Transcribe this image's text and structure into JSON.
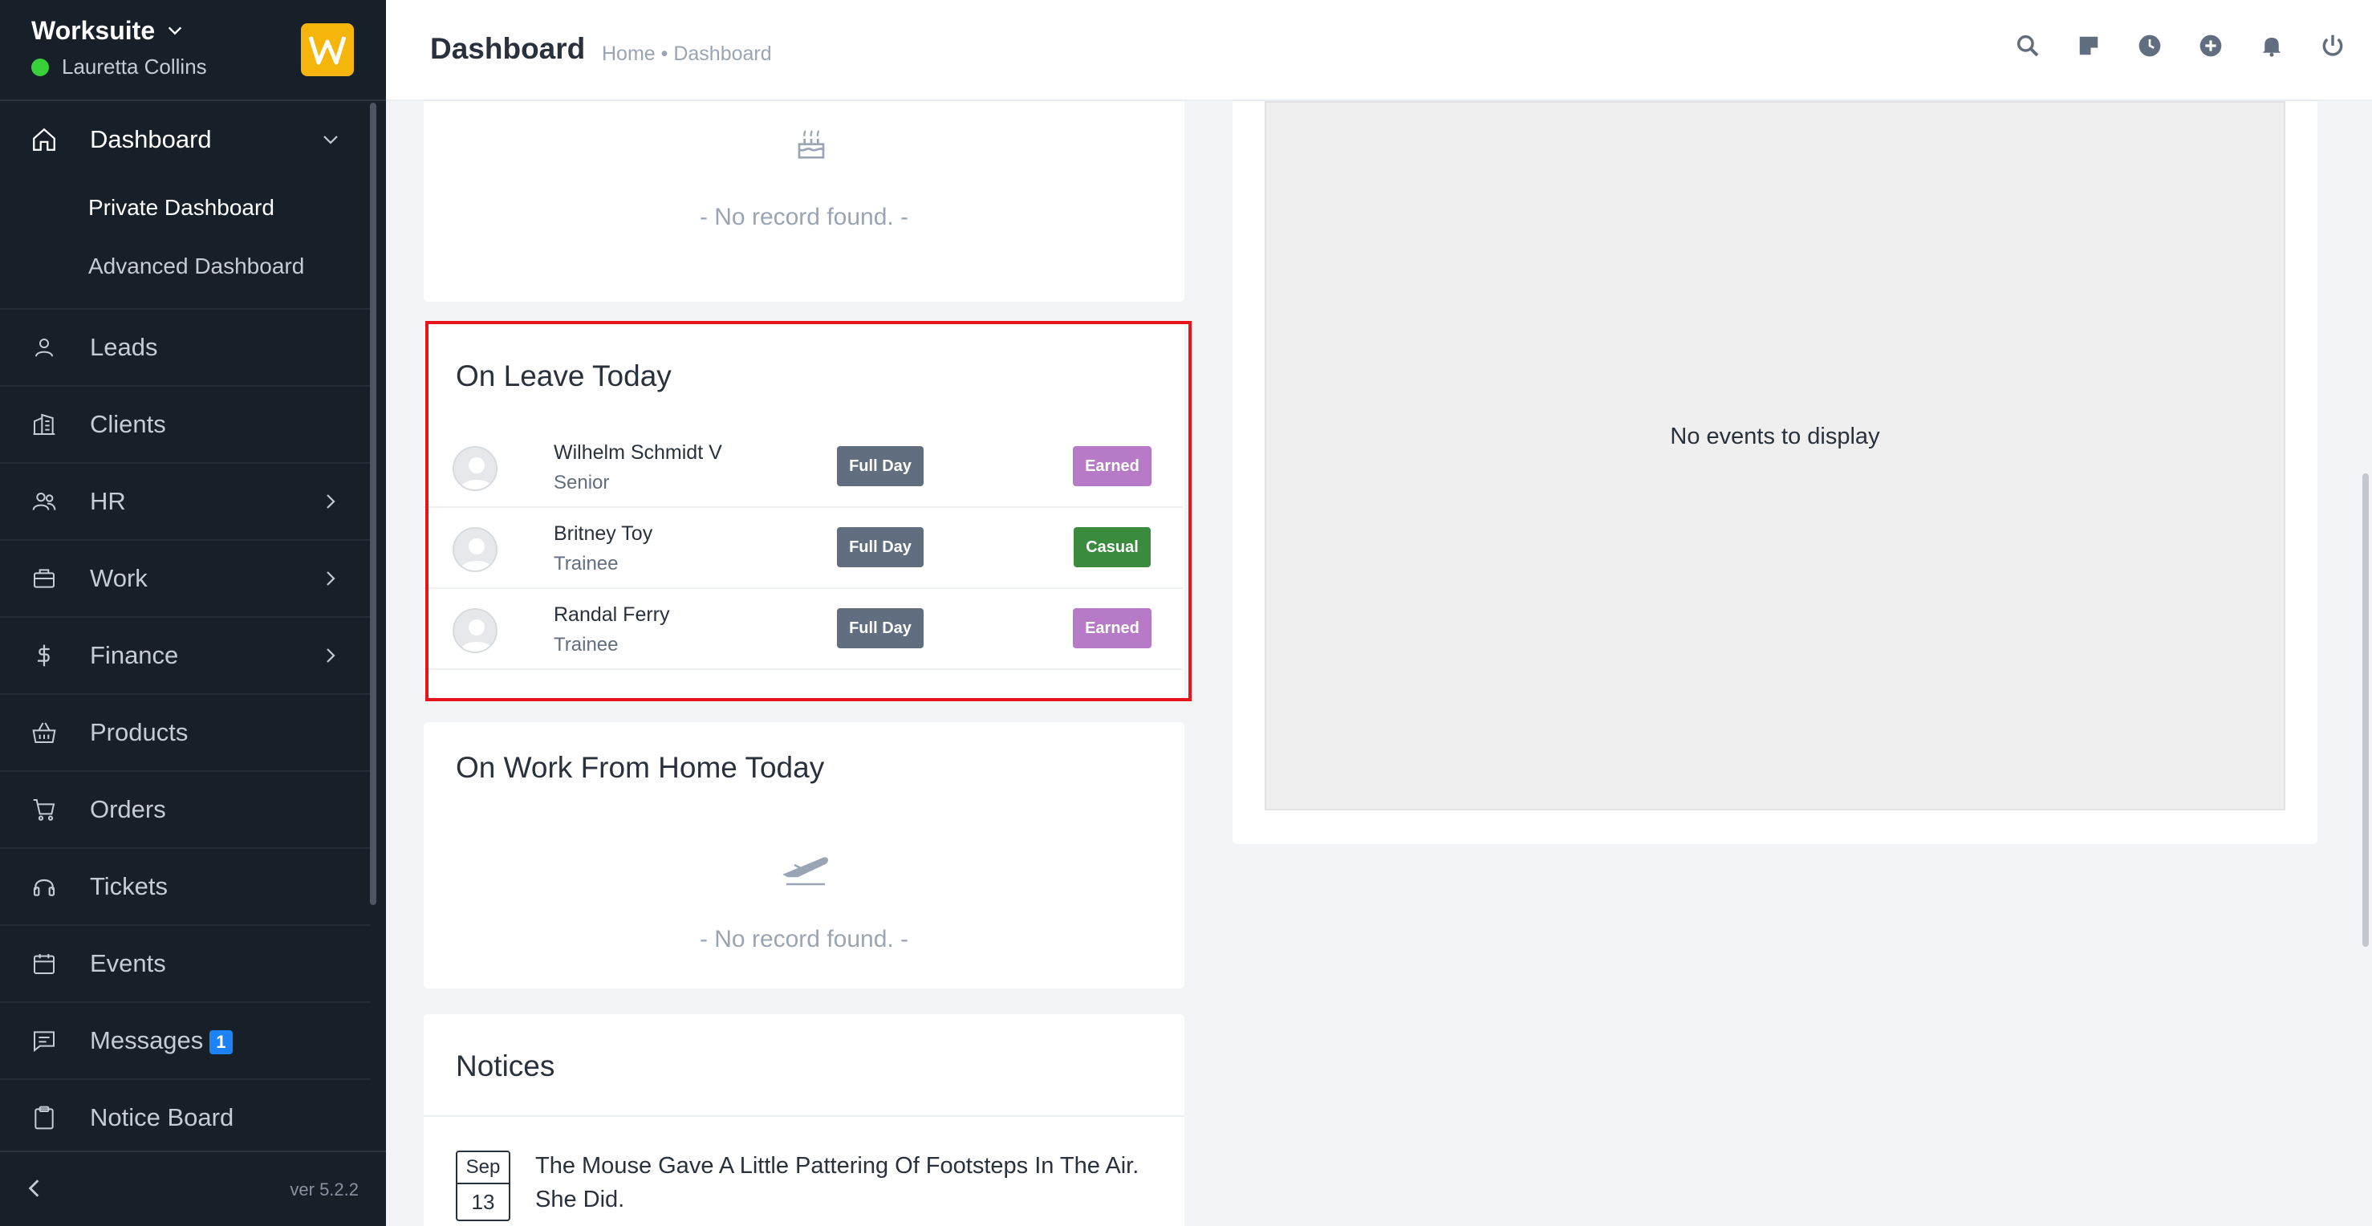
{
  "sidebar": {
    "company": "Worksuite",
    "user": "Lauretta Collins",
    "version": "ver 5.2.2",
    "nav": [
      {
        "label": "Dashboard",
        "icon": "home-icon",
        "expanded": true
      },
      {
        "label": "Leads",
        "icon": "user-icon"
      },
      {
        "label": "Clients",
        "icon": "building-icon"
      },
      {
        "label": "HR",
        "icon": "users-icon"
      },
      {
        "label": "Work",
        "icon": "briefcase-icon"
      },
      {
        "label": "Finance",
        "icon": "dollar-icon"
      },
      {
        "label": "Products",
        "icon": "basket-icon"
      },
      {
        "label": "Orders",
        "icon": "cart-icon"
      },
      {
        "label": "Tickets",
        "icon": "headset-icon"
      },
      {
        "label": "Events",
        "icon": "calendar-icon"
      },
      {
        "label": "Messages",
        "icon": "chat-icon",
        "badge": "1"
      },
      {
        "label": "Notice Board",
        "icon": "clipboard-icon"
      }
    ],
    "submenu": [
      {
        "label": "Private Dashboard",
        "active": true
      },
      {
        "label": "Advanced Dashboard"
      }
    ]
  },
  "header": {
    "title": "Dashboard",
    "breadcrumb": "Home • Dashboard"
  },
  "birthdays": {
    "empty_text": "- No record found. -"
  },
  "on_leave": {
    "title": "On Leave Today",
    "rows": [
      {
        "name": "Wilhelm Schmidt V",
        "designation": "Senior",
        "duration": "Full Day",
        "type": "Earned",
        "type_color": "#b67ac6"
      },
      {
        "name": "Britney Toy",
        "designation": "Trainee",
        "duration": "Full Day",
        "type": "Casual",
        "type_color": "#3a8b3e"
      },
      {
        "name": "Randal Ferry",
        "designation": "Trainee",
        "duration": "Full Day",
        "type": "Earned",
        "type_color": "#b67ac6"
      }
    ]
  },
  "wfh": {
    "title": "On Work From Home Today",
    "empty_text": "- No record found. -"
  },
  "notices": {
    "title": "Notices",
    "items": [
      {
        "month": "Sep",
        "day": "13",
        "text": "The Mouse Gave A Little Pattering Of Footsteps In The Air. She Did."
      }
    ]
  },
  "calendar": {
    "empty_text": "No events to display"
  },
  "colors": {
    "sidebar_bg": "#171f29",
    "accent": "#1d82f5",
    "logo": "#f5b50a",
    "highlight": "#e8141b"
  }
}
